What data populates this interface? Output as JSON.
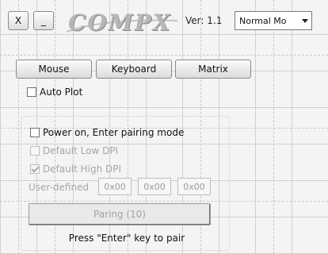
{
  "window": {
    "close_label": "X",
    "minimize_label": "_",
    "logo_text": "COMPX",
    "version_text": "Ver: 1.1",
    "mode_select": {
      "value": "Normal Mo"
    }
  },
  "tabs": [
    {
      "label": "Mouse"
    },
    {
      "label": "Keyboard"
    },
    {
      "label": "Matrix"
    }
  ],
  "auto_plot": {
    "label": "Auto Plot",
    "checked": false
  },
  "pairing": {
    "power_on": {
      "label": "Power on, Enter pairing mode",
      "checked": false
    },
    "default_low_dpi": {
      "label": "Default Low DPI",
      "checked": false,
      "enabled": false
    },
    "default_high_dpi": {
      "label": "Default High DPI",
      "checked": true,
      "enabled": false
    },
    "user_defined": {
      "label": "User-defined",
      "values": [
        "0x00",
        "0x00",
        "0x00"
      ]
    },
    "paring_button_label": "Paring (10)",
    "hint_text": "Press \"Enter\" key to pair"
  }
}
